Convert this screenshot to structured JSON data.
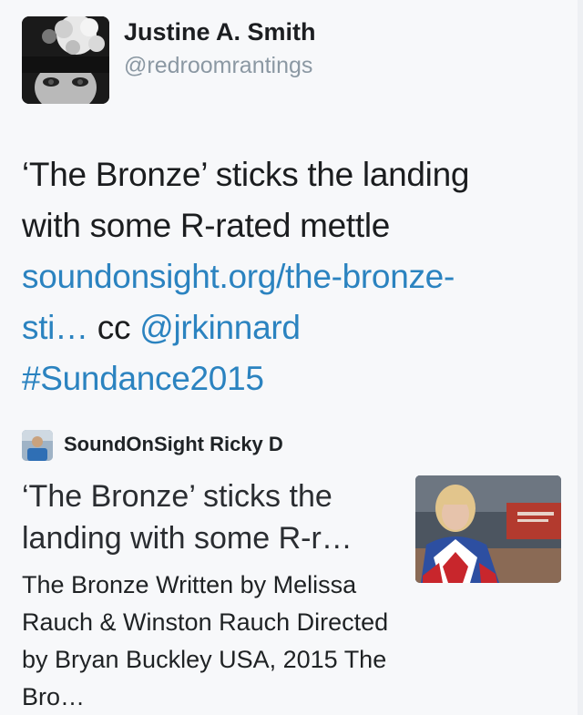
{
  "author": {
    "name": "Justine A. Smith",
    "handle": "@redroomrantings",
    "avatar_icon": "user-avatar-photo"
  },
  "tweet": {
    "text_line1": "‘The Bronze’ sticks the landing",
    "text_line2": "with some R-rated mettle",
    "link_line1": "soundonsight.org/the-bronze-",
    "link_line2": "sti…",
    "cc": " cc ",
    "mention": "@jrkinnard",
    "hashtag": "#Sundance2015"
  },
  "card": {
    "author_name": "SoundOnSight Ricky D",
    "author_avatar_icon": "card-author-avatar-photo",
    "title": "‘The Bronze’ sticks the landing with some R-r…",
    "description": "The Bronze Written by Melissa Rauch & Winston Rauch Directed by Bryan Buckley USA, 2015 The Bro…",
    "image_icon": "movie-still-thumbnail"
  },
  "colors": {
    "link": "#2b83c0",
    "handle": "#8b98a3",
    "text": "#1b1d1f",
    "background": "#f7f8fa"
  }
}
